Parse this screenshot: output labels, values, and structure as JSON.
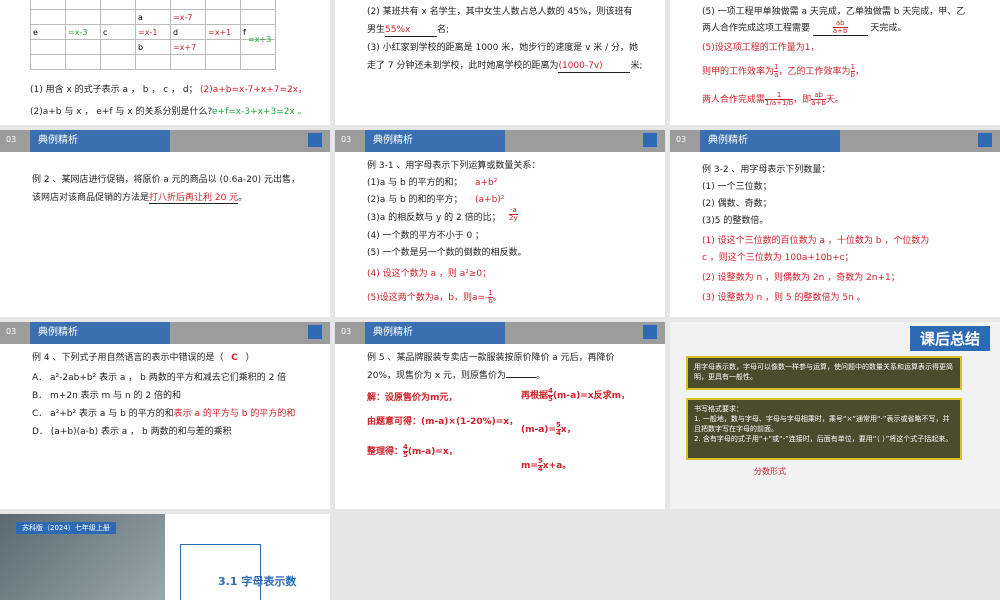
{
  "slide1": {
    "table_cells": [
      "a",
      "=x-7",
      "e",
      "=x-3",
      "c",
      "=x-1",
      "d",
      "=x+1",
      "f",
      "=x+3",
      "b",
      "=x+7"
    ],
    "q1": "(1) 用含 x 的式子表示 a ， b ， c ， d；",
    "a1": "(2)a+b=x-7+x+7=2x，",
    "q2": "(2)a+b 与 x ， e+f 与 x 的关系分别是什么?",
    "a2": "e+f=x-3+x+3=2x 。"
  },
  "slide2": {
    "l1": "(2) 某班共有 x 名学生，其中女生人数占总人数的 45%，则该班有",
    "l2a": "男生",
    "l2ans": "55%x",
    "l2b": "名;",
    "l3": "(3) 小红家到学校的距离是 1000 米，她步行的速度是 v 米 / 分，她",
    "l4a": "走了 7 分钟还未到学校，此时她离学校的距离为",
    "l4ans": "(1000-7v)",
    "l4b": "米;"
  },
  "slide3": {
    "l1": "(5) 一项工程甲单独做需 a 天完成，乙单独做需 b 天完成，甲、乙",
    "l2a": "两人合作完成这项工程需要",
    "l2ans_top": "ab",
    "l2ans_bot": "a+b",
    "l2b": "天完成。",
    "a1": "(5)设这项工程的工作量为1，",
    "a2a": "则甲的工作效率为",
    "a2b": "，乙的工作效率为",
    "a2c": "，",
    "a3a": "两人合作完成需",
    "a3b": "，即",
    "a3c": "天。"
  },
  "header": {
    "num": "03",
    "title": "典例精析"
  },
  "slide4": {
    "l1": "例 2 、某网店进行促销，将原价 a 元的商品以 (0.6a-20) 元出售，",
    "l2a": "该网店对该商品促销的方法是",
    "l2ans": "打八折后再让利 20 元",
    "l2b": "。"
  },
  "slide5": {
    "l1": "例 3-1 、用字母表示下列运算或数量关系：",
    "l2": "(1)a 与 b 的平方的和；",
    "l2ans": "a+b²",
    "l3": "(2)a 与 b 的和的平方；",
    "l3ans": "(a+b)²",
    "l4": "(3)a 的相反数与 y 的 2 倍的比；",
    "l4ans_top": "-a",
    "l4ans_bot": "2y",
    "l5": "(4) 一个数的平方不小于 0 ；",
    "l6": "(5) 一个数是另一个数的倒数的相反数。",
    "l7": "(4) 设这个数为 a ，则 a²≥0；",
    "l8a": "(5)设这两个数为a，b，则a=-",
    "l8b": "。"
  },
  "slide6": {
    "l1": "例 3-2 、用字母表示下列数量：",
    "l2": "(1) 一个三位数；",
    "l3": "(2) 偶数、奇数；",
    "l4": "(3)5 的整数倍。",
    "a1": "(1) 设这个三位数的百位数为 a ，十位数为 b ，个位数为",
    "a2": "c ，则这个三位数为 100a+10b+c；",
    "a3": "(2) 设整数为 n ，则偶数为 2n ，奇数为 2n+1；",
    "a4": "(3) 设整数为 n ，则 5 的整数倍为 5n 。"
  },
  "slide7": {
    "l1a": "例 4 、下列式子用自然语言的表示中错误的是（",
    "l1ans": "C",
    "l1b": "）",
    "A": "A． a²-2ab+b² 表示 a ， b 两数的平方和减去它们乘积的 2 倍",
    "B": "B． m+2n 表示 m 与 n 的 2 倍的和",
    "C1": "C． a²+b² 表示 a 与 b 的平方的和",
    "C2": "表示 a 的平方与 b 的平方的和",
    "D": "D． (a+b)(a-b) 表示 a ， b 两数的和与差的乘积"
  },
  "slide8": {
    "l1": "例 5 、某品牌服装专卖店一款服装按原价降价 a 元后，再降价",
    "l2a": "20%，现售价为 x 元，则原售价为",
    "l2b": "。",
    "s1": "解：设原售价为m元，",
    "s2": "由题意可得：(m-a)×(1-20%)=x，",
    "s3": "整理得：",
    "s3b": "(m-a)=x，",
    "r1a": "再根据",
    "r1b": "(m-a)=x反求m，",
    "r2": "(m-a)=",
    "r2b": "x，",
    "r3a": "m=",
    "r3b": "x+a。"
  },
  "slide9": {
    "tag": "课后总结",
    "box1": "用字母表示数，字母可以像数一样参与运算，使问题中的数量关系和运算表示得更简明，更具有一般性。",
    "box2_title": "书写格式要求：",
    "box2_1": "1. 一般地，数与字母、字母与字母相乘时，乘号“×”通常用“·”表示或省略不写，并且把数字写在字母的前面。",
    "box2_2": "2. 含有字母的式子用“+”或“-”连接时，后面有单位，要用“（ ）”将这个式子括起来。",
    "note": "分数形式"
  },
  "slide10": {
    "banner": "苏科版（2024）七年级上册",
    "title": "3.1  字母表示数"
  }
}
